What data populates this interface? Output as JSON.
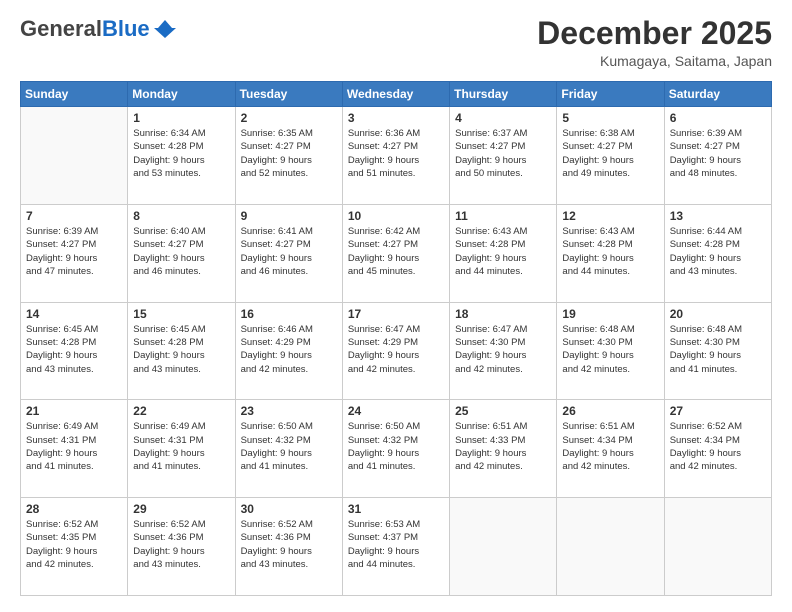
{
  "header": {
    "logo_general": "General",
    "logo_blue": "Blue",
    "month_title": "December 2025",
    "location": "Kumagaya, Saitama, Japan"
  },
  "weekdays": [
    "Sunday",
    "Monday",
    "Tuesday",
    "Wednesday",
    "Thursday",
    "Friday",
    "Saturday"
  ],
  "weeks": [
    [
      {
        "day": "",
        "info": ""
      },
      {
        "day": "1",
        "info": "Sunrise: 6:34 AM\nSunset: 4:28 PM\nDaylight: 9 hours\nand 53 minutes."
      },
      {
        "day": "2",
        "info": "Sunrise: 6:35 AM\nSunset: 4:27 PM\nDaylight: 9 hours\nand 52 minutes."
      },
      {
        "day": "3",
        "info": "Sunrise: 6:36 AM\nSunset: 4:27 PM\nDaylight: 9 hours\nand 51 minutes."
      },
      {
        "day": "4",
        "info": "Sunrise: 6:37 AM\nSunset: 4:27 PM\nDaylight: 9 hours\nand 50 minutes."
      },
      {
        "day": "5",
        "info": "Sunrise: 6:38 AM\nSunset: 4:27 PM\nDaylight: 9 hours\nand 49 minutes."
      },
      {
        "day": "6",
        "info": "Sunrise: 6:39 AM\nSunset: 4:27 PM\nDaylight: 9 hours\nand 48 minutes."
      }
    ],
    [
      {
        "day": "7",
        "info": "Sunrise: 6:39 AM\nSunset: 4:27 PM\nDaylight: 9 hours\nand 47 minutes."
      },
      {
        "day": "8",
        "info": "Sunrise: 6:40 AM\nSunset: 4:27 PM\nDaylight: 9 hours\nand 46 minutes."
      },
      {
        "day": "9",
        "info": "Sunrise: 6:41 AM\nSunset: 4:27 PM\nDaylight: 9 hours\nand 46 minutes."
      },
      {
        "day": "10",
        "info": "Sunrise: 6:42 AM\nSunset: 4:27 PM\nDaylight: 9 hours\nand 45 minutes."
      },
      {
        "day": "11",
        "info": "Sunrise: 6:43 AM\nSunset: 4:28 PM\nDaylight: 9 hours\nand 44 minutes."
      },
      {
        "day": "12",
        "info": "Sunrise: 6:43 AM\nSunset: 4:28 PM\nDaylight: 9 hours\nand 44 minutes."
      },
      {
        "day": "13",
        "info": "Sunrise: 6:44 AM\nSunset: 4:28 PM\nDaylight: 9 hours\nand 43 minutes."
      }
    ],
    [
      {
        "day": "14",
        "info": "Sunrise: 6:45 AM\nSunset: 4:28 PM\nDaylight: 9 hours\nand 43 minutes."
      },
      {
        "day": "15",
        "info": "Sunrise: 6:45 AM\nSunset: 4:28 PM\nDaylight: 9 hours\nand 43 minutes."
      },
      {
        "day": "16",
        "info": "Sunrise: 6:46 AM\nSunset: 4:29 PM\nDaylight: 9 hours\nand 42 minutes."
      },
      {
        "day": "17",
        "info": "Sunrise: 6:47 AM\nSunset: 4:29 PM\nDaylight: 9 hours\nand 42 minutes."
      },
      {
        "day": "18",
        "info": "Sunrise: 6:47 AM\nSunset: 4:30 PM\nDaylight: 9 hours\nand 42 minutes."
      },
      {
        "day": "19",
        "info": "Sunrise: 6:48 AM\nSunset: 4:30 PM\nDaylight: 9 hours\nand 42 minutes."
      },
      {
        "day": "20",
        "info": "Sunrise: 6:48 AM\nSunset: 4:30 PM\nDaylight: 9 hours\nand 41 minutes."
      }
    ],
    [
      {
        "day": "21",
        "info": "Sunrise: 6:49 AM\nSunset: 4:31 PM\nDaylight: 9 hours\nand 41 minutes."
      },
      {
        "day": "22",
        "info": "Sunrise: 6:49 AM\nSunset: 4:31 PM\nDaylight: 9 hours\nand 41 minutes."
      },
      {
        "day": "23",
        "info": "Sunrise: 6:50 AM\nSunset: 4:32 PM\nDaylight: 9 hours\nand 41 minutes."
      },
      {
        "day": "24",
        "info": "Sunrise: 6:50 AM\nSunset: 4:32 PM\nDaylight: 9 hours\nand 41 minutes."
      },
      {
        "day": "25",
        "info": "Sunrise: 6:51 AM\nSunset: 4:33 PM\nDaylight: 9 hours\nand 42 minutes."
      },
      {
        "day": "26",
        "info": "Sunrise: 6:51 AM\nSunset: 4:34 PM\nDaylight: 9 hours\nand 42 minutes."
      },
      {
        "day": "27",
        "info": "Sunrise: 6:52 AM\nSunset: 4:34 PM\nDaylight: 9 hours\nand 42 minutes."
      }
    ],
    [
      {
        "day": "28",
        "info": "Sunrise: 6:52 AM\nSunset: 4:35 PM\nDaylight: 9 hours\nand 42 minutes."
      },
      {
        "day": "29",
        "info": "Sunrise: 6:52 AM\nSunset: 4:36 PM\nDaylight: 9 hours\nand 43 minutes."
      },
      {
        "day": "30",
        "info": "Sunrise: 6:52 AM\nSunset: 4:36 PM\nDaylight: 9 hours\nand 43 minutes."
      },
      {
        "day": "31",
        "info": "Sunrise: 6:53 AM\nSunset: 4:37 PM\nDaylight: 9 hours\nand 44 minutes."
      },
      {
        "day": "",
        "info": ""
      },
      {
        "day": "",
        "info": ""
      },
      {
        "day": "",
        "info": ""
      }
    ]
  ]
}
